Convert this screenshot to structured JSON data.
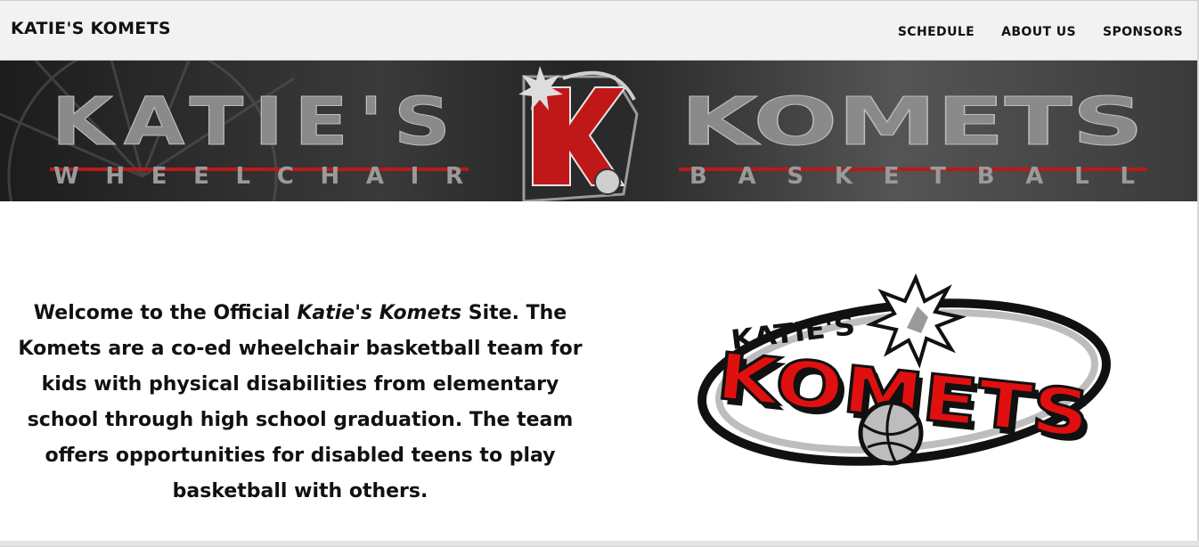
{
  "header": {
    "site_title": "KATIE'S KOMETS",
    "nav": [
      {
        "label": "SCHEDULE"
      },
      {
        "label": "ABOUT US"
      },
      {
        "label": "SPONSORS"
      }
    ]
  },
  "banner": {
    "word_left_big": "KATIE'S",
    "word_left_small": "W H E E L C H A I R",
    "word_right_big": "KOMETS",
    "word_right_small": "B A S K E T B A L L",
    "monogram": "K"
  },
  "main": {
    "intro_before": "Welcome to the Official ",
    "intro_italic": "Katie's Komets",
    "intro_after": " Site. The Komets are a co-ed wheelchair basketball team for kids with physical disabilities from elementary school through high school graduation. The team offers opportunities for disabled teens to play basketball with others.",
    "logo_top": "KATIE'S",
    "logo_main": "KOMETS"
  },
  "colors": {
    "accent_red": "#e01010",
    "dark": "#111111",
    "banner_text_gray": "#8a8a8a"
  }
}
